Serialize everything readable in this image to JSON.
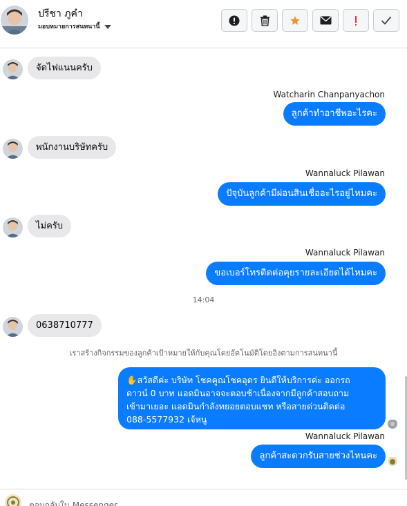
{
  "header": {
    "contact_name": "ปรีชา ภูคำ",
    "assign_label": "มอบหมายการสนทนานี้",
    "toolbar": [
      {
        "name": "spam-button",
        "icon": "exclamation-circle-icon"
      },
      {
        "name": "delete-button",
        "icon": "trash-icon"
      },
      {
        "name": "star-button",
        "icon": "star-icon"
      },
      {
        "name": "mark-unread-button",
        "icon": "envelope-icon"
      },
      {
        "name": "follow-up-button",
        "icon": "exclamation-icon"
      },
      {
        "name": "mark-done-button",
        "icon": "check-icon"
      }
    ]
  },
  "colors": {
    "accent": "#0a7cff",
    "incoming_bubble": "#e8e8eb",
    "star": "#f5922b",
    "alert": "#e4343c"
  },
  "messages": {
    "m1": "จัดไฟแนนครับ",
    "s2": "Watcharin Chanpanyachon",
    "m2": "ลูกค้าทำอาชีพอะไรคะ",
    "m3": "พนักงานบริษัทครับ",
    "s4": "Wannaluck Pilawan",
    "m4": "ปัจุบันลูกค้ามีผ่อนสินเชื่ออะไรอยู่ไหมคะ",
    "m5": "ไม่ครับ",
    "s6": "Wannaluck Pilawan",
    "m6": "ขอเบอร์โทรติดต่อคุยรายละเอียดได้ไหมคะ",
    "time": "14:04",
    "m7": "0638710777",
    "system_note": "เราสร้างกิจกรรมของลูกค้าเป้าหมายให้กับคุณโดยอัตโนมัติโดยอิงตามการสนทนานี้",
    "m8_lines": [
      "✋สวัสดีค่ะ บริษัท โชคคูณโชคอุดร ยินดีให้บริการค่ะ ออกรถ",
      "ดาวน์ 0 บาท แอดมินอาจจะตอบช้าเนื่องจากมีลูกค้าสอบถาม",
      "เข้ามาเยอะ แอดมินกำลังทยอยตอบแชท หรือสายด่วนติดต่อ",
      "088-5577932 เจ้หนู"
    ],
    "s9": "Wannaluck Pilawan",
    "m9": "ลูกค้าสะดวกรับสายช่วงไหนคะ"
  },
  "composer": {
    "placeholder": "ตอบกลับใน Messenger"
  }
}
